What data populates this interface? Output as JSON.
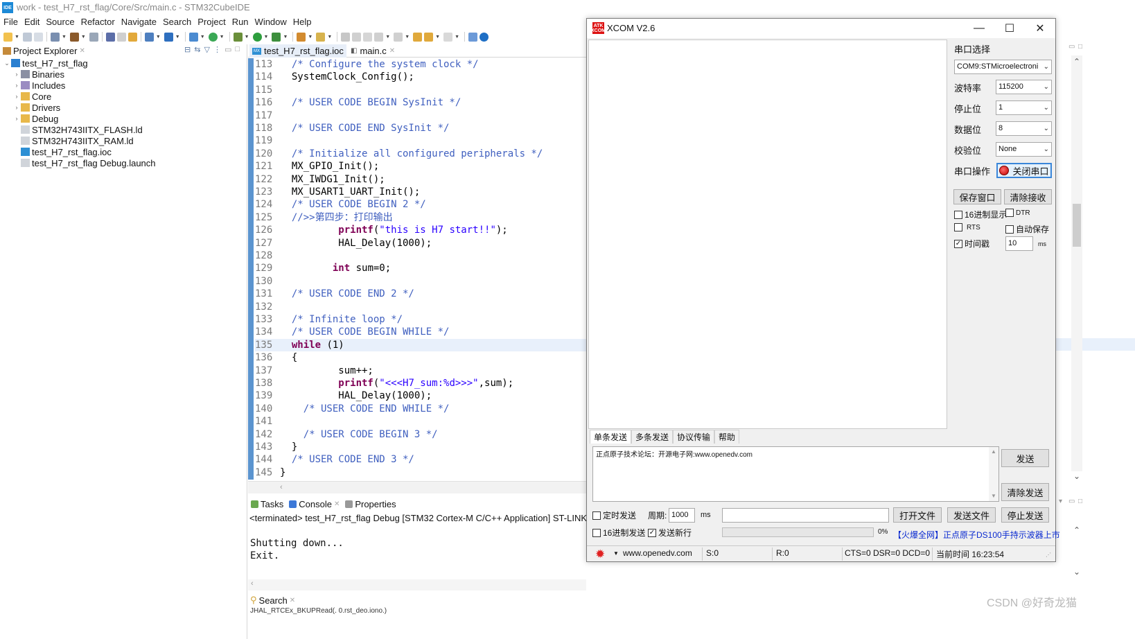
{
  "app": {
    "title": "work - test_H7_rst_flag/Core/Src/main.c - STM32CubeIDE",
    "badge": "IDE"
  },
  "menu": [
    "File",
    "Edit",
    "Source",
    "Refactor",
    "Navigate",
    "Search",
    "Project",
    "Run",
    "Window",
    "Help"
  ],
  "explorer": {
    "title": "Project Explorer",
    "project": "test_H7_rst_flag",
    "items": [
      {
        "label": "Binaries",
        "icon": "binaries-icon",
        "expandable": true
      },
      {
        "label": "Includes",
        "icon": "includes-icon",
        "expandable": true
      },
      {
        "label": "Core",
        "icon": "folder-icon",
        "expandable": true
      },
      {
        "label": "Drivers",
        "icon": "folder-icon",
        "expandable": true
      },
      {
        "label": "Debug",
        "icon": "folder-icon",
        "expandable": true
      },
      {
        "label": "STM32H743IITX_FLASH.ld",
        "icon": "file-icon",
        "expandable": false
      },
      {
        "label": "STM32H743IITX_RAM.ld",
        "icon": "file-icon",
        "expandable": false
      },
      {
        "label": "test_H7_rst_flag.ioc",
        "icon": "ioc-file-icon",
        "expandable": false
      },
      {
        "label": "test_H7_rst_flag Debug.launch",
        "icon": "file-icon",
        "expandable": false
      }
    ]
  },
  "editor": {
    "tabs": [
      {
        "label": "test_H7_rst_flag.ioc",
        "icon": "ioc-file-icon",
        "mx": "MX"
      },
      {
        "label": "main.c",
        "icon": "c-file-icon"
      }
    ],
    "current_line": 135,
    "lines": [
      {
        "n": "113",
        "segs": [
          {
            "t": "  /* Configure the system clock */",
            "c": "c-comment"
          }
        ]
      },
      {
        "n": "114",
        "segs": [
          {
            "t": "  SystemClock_Config();",
            "c": "c-fn"
          }
        ]
      },
      {
        "n": "115",
        "segs": []
      },
      {
        "n": "116",
        "segs": [
          {
            "t": "  /* USER CODE BEGIN SysInit */",
            "c": "c-comment"
          }
        ]
      },
      {
        "n": "117",
        "segs": []
      },
      {
        "n": "118",
        "segs": [
          {
            "t": "  /* USER CODE END SysInit */",
            "c": "c-comment"
          }
        ]
      },
      {
        "n": "119",
        "segs": []
      },
      {
        "n": "120",
        "segs": [
          {
            "t": "  /* Initialize all configured peripherals */",
            "c": "c-comment"
          }
        ]
      },
      {
        "n": "121",
        "segs": [
          {
            "t": "  MX_GPIO_Init();",
            "c": "c-fn"
          }
        ]
      },
      {
        "n": "122",
        "segs": [
          {
            "t": "  MX_IWDG1_Init();",
            "c": "c-fn"
          }
        ]
      },
      {
        "n": "123",
        "segs": [
          {
            "t": "  MX_USART1_UART_Init();",
            "c": "c-fn"
          }
        ]
      },
      {
        "n": "124",
        "segs": [
          {
            "t": "  /* USER CODE BEGIN 2 */",
            "c": "c-comment"
          }
        ]
      },
      {
        "n": "125",
        "segs": [
          {
            "t": "  //>>第四步：打印输出",
            "c": "c-comment"
          }
        ]
      },
      {
        "n": "126",
        "segs": [
          {
            "t": "          printf",
            "c": "c-kw"
          },
          {
            "t": "(",
            "c": "c-fn"
          },
          {
            "t": "\"this is H7 start!!\"",
            "c": "c-str"
          },
          {
            "t": ");",
            "c": "c-fn"
          }
        ]
      },
      {
        "n": "127",
        "segs": [
          {
            "t": "          HAL_Delay(1000);",
            "c": "c-fn"
          }
        ]
      },
      {
        "n": "128",
        "segs": []
      },
      {
        "n": "129",
        "segs": [
          {
            "t": "         ",
            "c": "c-fn"
          },
          {
            "t": "int",
            "c": "c-kw"
          },
          {
            "t": " sum=0;",
            "c": "c-fn"
          }
        ]
      },
      {
        "n": "130",
        "segs": []
      },
      {
        "n": "131",
        "segs": [
          {
            "t": "  /* USER CODE END 2 */",
            "c": "c-comment"
          }
        ]
      },
      {
        "n": "132",
        "segs": []
      },
      {
        "n": "133",
        "segs": [
          {
            "t": "  /* Infinite loop */",
            "c": "c-comment"
          }
        ]
      },
      {
        "n": "134",
        "segs": [
          {
            "t": "  /* USER CODE BEGIN WHILE */",
            "c": "c-comment"
          }
        ]
      },
      {
        "n": "135",
        "segs": [
          {
            "t": "  ",
            "c": "c-fn"
          },
          {
            "t": "while",
            "c": "c-kw"
          },
          {
            "t": " (1)",
            "c": "c-fn"
          }
        ]
      },
      {
        "n": "136",
        "segs": [
          {
            "t": "  {",
            "c": "c-fn"
          }
        ]
      },
      {
        "n": "137",
        "segs": [
          {
            "t": "          sum++;",
            "c": "c-fn"
          }
        ]
      },
      {
        "n": "138",
        "segs": [
          {
            "t": "          printf",
            "c": "c-kw"
          },
          {
            "t": "(",
            "c": "c-fn"
          },
          {
            "t": "\"<<<H7_sum:%d>>>\"",
            "c": "c-str"
          },
          {
            "t": ",sum);",
            "c": "c-fn"
          }
        ]
      },
      {
        "n": "139",
        "segs": [
          {
            "t": "          HAL_Delay(1000);",
            "c": "c-fn"
          }
        ]
      },
      {
        "n": "140",
        "segs": [
          {
            "t": "    /* USER CODE END WHILE */",
            "c": "c-comment"
          }
        ]
      },
      {
        "n": "141",
        "segs": []
      },
      {
        "n": "142",
        "segs": [
          {
            "t": "    /* USER CODE BEGIN 3 */",
            "c": "c-comment"
          }
        ]
      },
      {
        "n": "143",
        "segs": [
          {
            "t": "  }",
            "c": "c-fn"
          }
        ]
      },
      {
        "n": "144",
        "segs": [
          {
            "t": "  /* USER CODE END 3 */",
            "c": "c-comment"
          }
        ]
      },
      {
        "n": "145",
        "segs": [
          {
            "t": "}",
            "c": "c-fn"
          }
        ]
      }
    ]
  },
  "console": {
    "tabs": [
      {
        "label": "Tasks",
        "icon": "tasks-icon",
        "color": "#6aa84f"
      },
      {
        "label": "Console",
        "icon": "console-icon",
        "color": "#3c78d8"
      },
      {
        "label": "Properties",
        "icon": "properties-icon",
        "color": "#999999"
      }
    ],
    "status": "<terminated> test_H7_rst_flag Debug [STM32 Cortex-M C/C++ Application] ST-LINK (ST-",
    "output": "Shutting down...\nExit.",
    "search_tab": "Search",
    "bottom_cut": "JHAL_RTCEx_BKUPRead(. 0.rst_deo.iono.)"
  },
  "xcom": {
    "title": "XCOM V2.6",
    "logo": "ATK XCOM",
    "port_select_label": "串口选择",
    "port_value": "COM9:STMicroelectroni",
    "baud_label": "波特率",
    "baud_value": "115200",
    "stop_label": "停止位",
    "stop_value": "1",
    "data_label": "数据位",
    "data_value": "8",
    "parity_label": "校验位",
    "parity_value": "None",
    "op_label": "串口操作",
    "close_port": "关闭串口",
    "save_window": "保存窗口",
    "clear_recv": "清除接收",
    "hex_display": "16进制显示",
    "dtr": "DTR",
    "rts": "RTS",
    "auto_save": "自动保存",
    "timestamp": "时间戳",
    "timestamp_value": "10",
    "timestamp_unit": "ms",
    "tabs": [
      "单条发送",
      "多条发送",
      "协议传输",
      "帮助"
    ],
    "send_text": "正点原子技术论坛：开源电子网:www.openedv.com",
    "send_button": "发送",
    "clear_send": "清除发送",
    "timed_send": "定时发送",
    "period_label": "周期:",
    "period_value": "1000",
    "period_unit": "ms",
    "open_file": "打开文件",
    "send_file": "发送文件",
    "stop_send": "停止发送",
    "hex_send": "16进制发送",
    "send_newline": "发送新行",
    "progress_percent": "0%",
    "promo": "【火爆全网】正点原子DS100手持示波器上市",
    "status": {
      "url": "www.openedv.com",
      "sent": "S:0",
      "recv": "R:0",
      "lines": "CTS=0 DSR=0 DCD=0",
      "time": "当前时间 16:23:54"
    }
  },
  "watermark": "CSDN @好奇龙猫"
}
